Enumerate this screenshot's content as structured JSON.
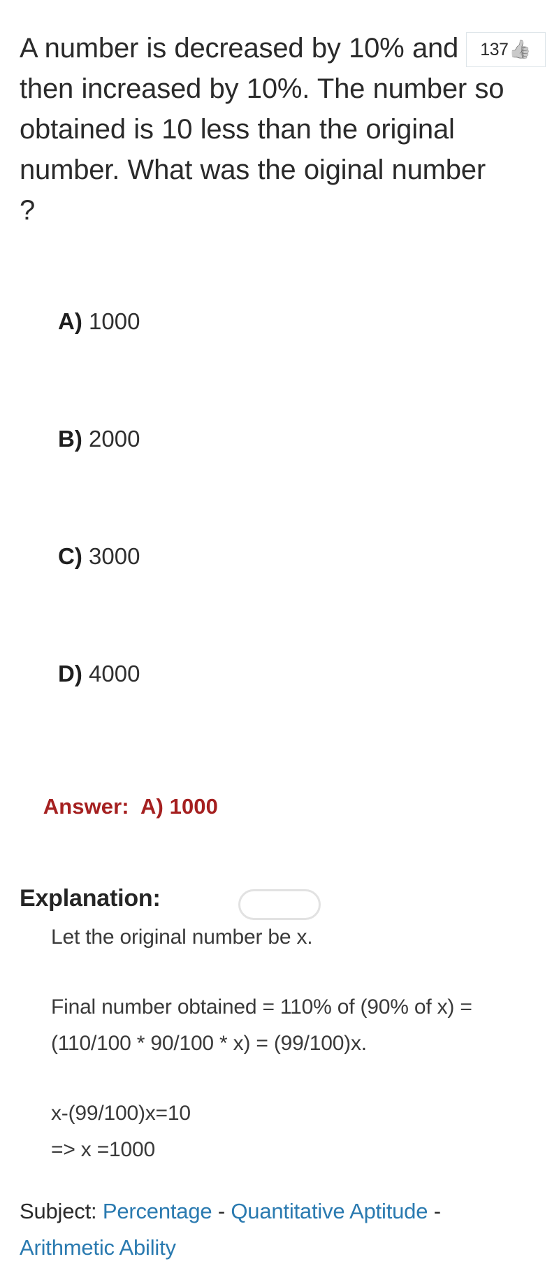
{
  "vote": {
    "count": "137",
    "icon": "thumbs-up-icon",
    "glyph": "👍"
  },
  "question": {
    "text": "A number is decreased by 10% and then increased by 10%.  The number so obtained is 10 less than the original number. What was the oiginal number ?"
  },
  "options": [
    {
      "key": "A)",
      "value": "1000"
    },
    {
      "key": "B)",
      "value": "2000"
    },
    {
      "key": "C)",
      "value": "3000"
    },
    {
      "key": "D)",
      "value": "4000"
    }
  ],
  "answer": {
    "label": "Answer:",
    "value": "A) 1000",
    "full": "Answer:  A) 1000",
    "color": "#a52020"
  },
  "explanation": {
    "heading": "Explanation:",
    "paragraphs": [
      "Let the original number be x.",
      "Final number obtained = 110% of (90% of x) = (110/100 * 90/100 * x) = (99/100)x.",
      "x-(99/100)x=10",
      "=> x =1000"
    ]
  },
  "subject": {
    "label": "Subject:",
    "links": [
      "Percentage",
      "Quantitative Aptitude",
      "Arithmetic Ability"
    ],
    "separator": "-",
    "link_color": "#2a7ab0"
  }
}
